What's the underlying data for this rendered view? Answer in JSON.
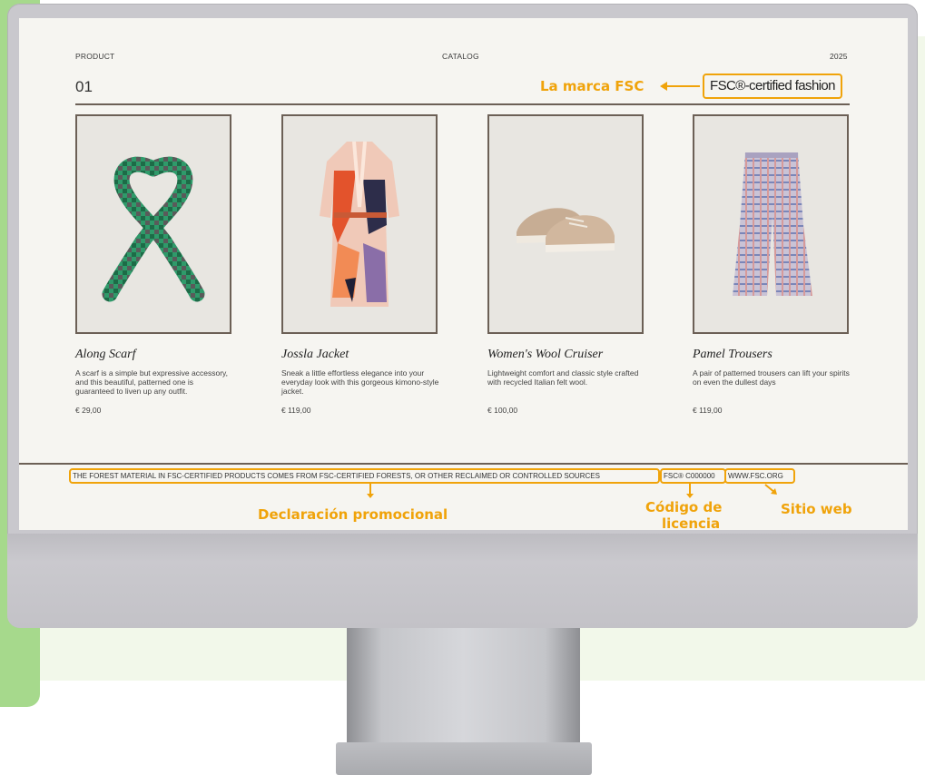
{
  "catalog": {
    "header_left": "PRODUCT",
    "header_center": "CATALOG",
    "header_right": "2025",
    "page_number": "01",
    "fsc_tagline": "FSC®-certified fashion"
  },
  "callouts": {
    "brand": "La marca FSC",
    "promo": "Declaración promocional",
    "license_line1": "Código de",
    "license_line2": "licencia",
    "website": "Sitio web"
  },
  "products": [
    {
      "name": "Along Scarf",
      "description": "A scarf is a simple but expressive accessory, and this beautiful, patterned one is guaranteed to liven up any outfit.",
      "price": "€ 29,00"
    },
    {
      "name": "Jossla Jacket",
      "description": "Sneak a little effortless elegance into your everyday look with this gorgeous kimono-style jacket.",
      "price": "€ 119,00"
    },
    {
      "name": "Women's Wool Cruiser",
      "description": "Lightweight comfort and classic style crafted with recycled Italian felt wool.",
      "price": "€ 100,00"
    },
    {
      "name": "Pamel Trousers",
      "description": "A pair of patterned trousers can lift your spirits on even the dullest days",
      "price": "€ 119,00"
    }
  ],
  "footer": {
    "statement": "THE FOREST MATERIAL IN FSC-CERTIFIED PRODUCTS COMES FROM FSC-CERTIFIED FORESTS, OR OTHER RECLAIMED OR CONTROLLED SOURCES",
    "license_code": "FSC® C000000",
    "website": "WWW.FSC.ORG"
  },
  "colors": {
    "accent": "#f0a30a",
    "rule": "#6c6056",
    "screen_bg": "#f6f5f1",
    "green_panel": "#a6d98c"
  }
}
